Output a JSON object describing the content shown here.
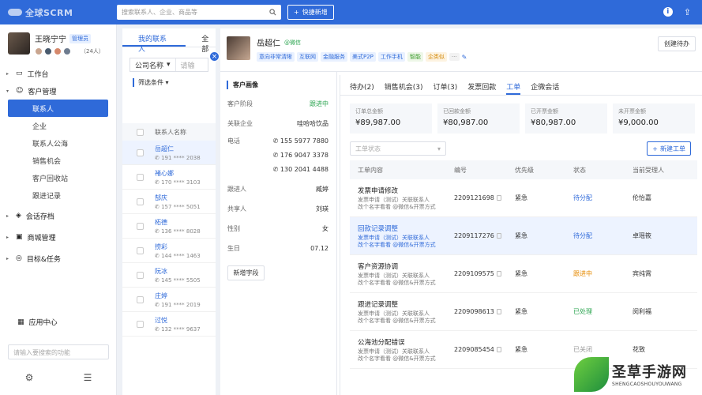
{
  "topbar": {
    "logo_text": "全球SCRM",
    "search_placeholder": "搜索联系人、企业、商品等",
    "quick_new_label": "快捷新增"
  },
  "profile": {
    "name": "王晓宁宁",
    "role": "管理员",
    "count": "（24人）"
  },
  "nav": {
    "workbench": "工作台",
    "customer_mgmt": "客户管理",
    "sub": [
      "联系人",
      "企业",
      "联系人公海",
      "销售机会",
      "客户回收站",
      "跟进记录"
    ],
    "session_archive": "会话存档",
    "mall_mgmt": "商城管理",
    "goals_tasks": "目标&任务",
    "app_center": "应用中心",
    "search_placeholder": "请输入要搜索的功能"
  },
  "list": {
    "tabs": [
      "我的联系人",
      "全部"
    ],
    "filter_field": "公司名称",
    "filter_placeholder": "请输",
    "filter_conditions": "筛选条件",
    "column": "联系人名称",
    "rows": [
      {
        "name": "岳超仁",
        "phone": "191 **** 2038"
      },
      {
        "name": "褚心娜",
        "phone": "170 **** 3103"
      },
      {
        "name": "郜庆",
        "phone": "157 **** 5051"
      },
      {
        "name": "柘德",
        "phone": "136 **** 8028"
      },
      {
        "name": "捞彩",
        "phone": "144 **** 1463"
      },
      {
        "name": "阮冰",
        "phone": "145 **** 5505"
      },
      {
        "name": "庄婷",
        "phone": "191 **** 2019"
      },
      {
        "name": "过悦",
        "phone": "132 **** 9637"
      }
    ]
  },
  "detail": {
    "name": "岳超仁",
    "wechat": "@微信",
    "tags": [
      "意向非常清晰",
      "互联网",
      "金融服务",
      "美式P2P",
      "工作手机",
      "智能",
      "企类似",
      "···"
    ],
    "create_todo": "创建待办",
    "portrait_title": "客户画像",
    "fields": [
      {
        "key": "客户阶段",
        "value": "跟进中"
      },
      {
        "key": "关联企业",
        "value": "哇哈哈饮品"
      }
    ],
    "phone_label": "电话",
    "phones": [
      "155 5977 7880",
      "176 9047 3378",
      "130 2041 4488"
    ],
    "fields2": [
      {
        "key": "跟进人",
        "value": "臧婷"
      },
      {
        "key": "共享人",
        "value": "刘瑛"
      },
      {
        "key": "性别",
        "value": "女"
      },
      {
        "key": "生日",
        "value": "07.12"
      }
    ],
    "add_field": "新增字段"
  },
  "workorders": {
    "tabs": [
      "待办(2)",
      "销售机会(3)",
      "订单(3)",
      "发票回款",
      "工单",
      "企微会话"
    ],
    "stats": [
      {
        "label": "订单总金额",
        "value": "¥89,987.00"
      },
      {
        "label": "已回款金额",
        "value": "¥80,987.00"
      },
      {
        "label": "已开票金额",
        "value": "¥80,987.00"
      },
      {
        "label": "未开票金额",
        "value": "¥9,000.00"
      }
    ],
    "status_placeholder": "工单状态",
    "new_button": "新建工单",
    "columns": [
      "工单内容",
      "编号",
      "优先级",
      "状态",
      "当前受理人"
    ],
    "rows": [
      {
        "title": "发票申请修改",
        "sub1": "发票申请（测试）关联联系人",
        "sub2": "改个名字看看 @微信&开票方式",
        "number": "2209121698",
        "priority": "紧急",
        "status": "待分配",
        "status_color": "#2f6ad9",
        "assignee": "伦怡嘉"
      },
      {
        "title": "回款记录调整",
        "sub1": "发票申请（测试）关联联系人",
        "sub2": "改个名字看看 @微信&开票方式",
        "number": "2209117276",
        "priority": "紧急",
        "status": "待分配",
        "status_color": "#2f6ad9",
        "assignee": "卓瑶筱"
      },
      {
        "title": "客户资源协调",
        "sub1": "发票申请（测试）关联联系人",
        "sub2": "改个名字看看 @微信&开票方式",
        "number": "2209109575",
        "priority": "紧急",
        "status": "跟进中",
        "status_color": "#e68a00",
        "assignee": "宾纯霄"
      },
      {
        "title": "跟进记录调整",
        "sub1": "发票申请（测试）关联联系人",
        "sub2": "改个名字看看 @微信&开票方式",
        "number": "2209098613",
        "priority": "紧急",
        "status": "已处理",
        "status_color": "#2aa44f",
        "assignee": "闵利福"
      },
      {
        "title": "公海池分配错误",
        "sub1": "发票申请（测试）关联联系人",
        "sub2": "改个名字看看 @微信&开票方式",
        "number": "2209085454",
        "priority": "紧急",
        "status": "已关闭",
        "status_color": "#999999",
        "assignee": "花致"
      }
    ]
  },
  "watermark": {
    "cn": "圣草手游网",
    "en": "SHENGCAOSHOUYOUWANG"
  }
}
